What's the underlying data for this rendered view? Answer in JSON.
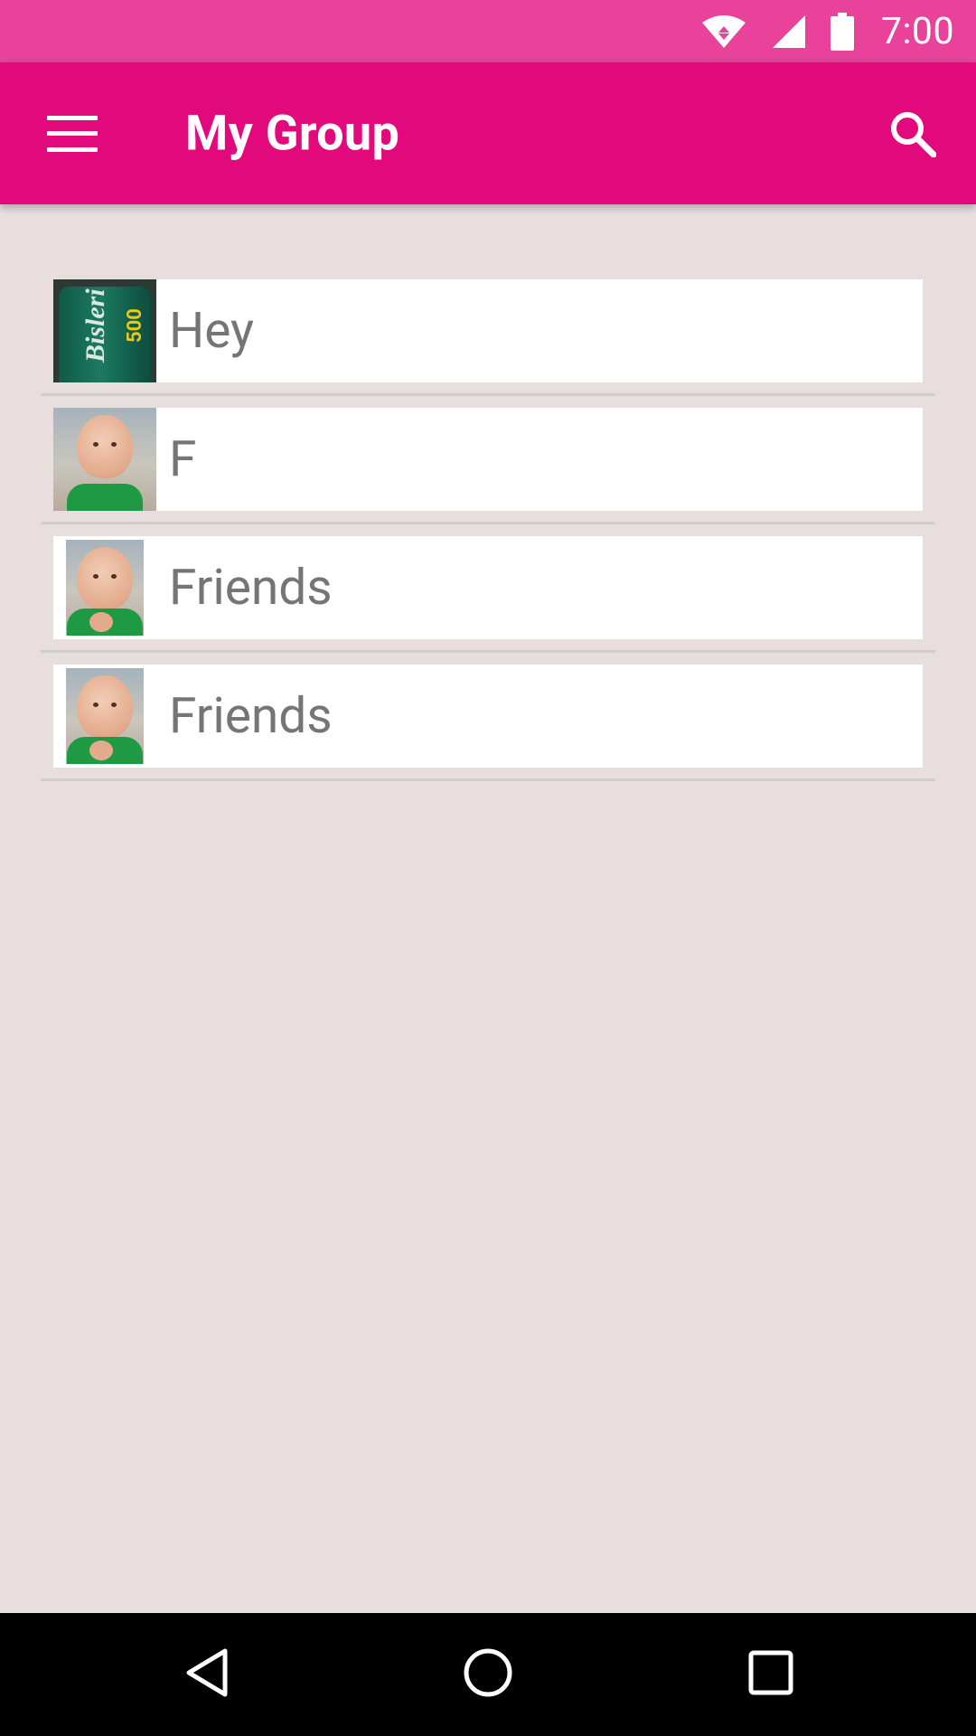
{
  "status_bar": {
    "time": "7:00",
    "icons": [
      "wifi-icon",
      "cell-signal-icon",
      "battery-icon"
    ],
    "background": "#e8429a"
  },
  "app_bar": {
    "title": "My Group",
    "background": "#e2097c",
    "left_icon": "hamburger-menu-icon",
    "right_icon": "search-icon"
  },
  "groups": [
    {
      "label": "Hey",
      "thumbnail": "bottle-photo"
    },
    {
      "label": "F",
      "thumbnail": "baby-photo"
    },
    {
      "label": "Friends",
      "thumbnail": "baby-photo"
    },
    {
      "label": "Friends",
      "thumbnail": "baby-photo"
    }
  ],
  "nav_bar": {
    "icons": [
      "back-icon",
      "home-icon",
      "recents-icon"
    ]
  },
  "colors": {
    "page_background": "#e9dede",
    "list_text": "#757575",
    "divider": "#cfcdcd"
  }
}
